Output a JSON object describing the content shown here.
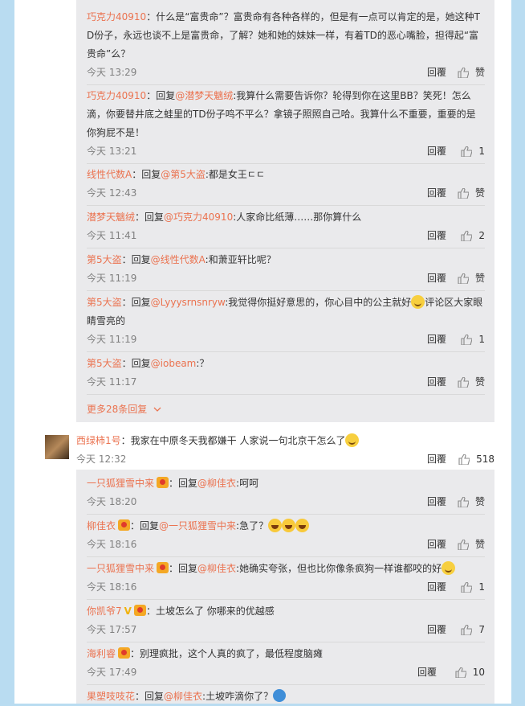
{
  "replies_top": [
    {
      "user": "巧克力40910",
      "prefix": "：",
      "mention": "",
      "text": "什么是“富贵命”？富贵命有各种各样的，但是有一点可以肯定的是，她这种TD份子，永远也谈不上是富贵命，了解？她和她的妹妹一样，有着TD的恶心嘴脸，担得起“富贵命”么？",
      "time": "今天 13:29",
      "reply_label": "回覆",
      "like": "赞"
    },
    {
      "user": "巧克力40910",
      "prefix": "：回复",
      "mention": "@潜梦天魑绒",
      "text": ":我算什么需要告诉你？轮得到你在这里BB？笑死！怎么滴，你要替井底之蛙里的TD份子鸣不平么？拿镜子照照自己哈。我算什么不重要，重要的是你狗屁不是！",
      "time": "今天 13:21",
      "reply_label": "回覆",
      "like": "1"
    },
    {
      "user": "线性代数A",
      "prefix": "：回复",
      "mention": "@第5大盗",
      "text": ":都是女王ㄷㄷ",
      "time": "今天 12:43",
      "reply_label": "回覆",
      "like": "赞"
    },
    {
      "user": "潜梦天魑绒",
      "prefix": "：回复",
      "mention": "@巧克力40910",
      "text": ":人家命比纸薄……那你算什么",
      "time": "今天 11:41",
      "reply_label": "回覆",
      "like": "2"
    },
    {
      "user": "第5大盗",
      "prefix": "：回复",
      "mention": "@线性代数A",
      "text": ":和萧亚轩比呢？",
      "time": "今天 11:19",
      "reply_label": "回覆",
      "like": "赞"
    },
    {
      "user": "第5大盗",
      "prefix": "：回复",
      "mention": "@Lyyysrnsnryw",
      "text": ":我觉得你挺好意思的，你心目中的公主就好",
      "text2": "评论区大家眼睛雪亮的",
      "time": "今天 11:19",
      "reply_label": "回覆",
      "like": "1"
    },
    {
      "user": "第5大盗",
      "prefix": "：回复",
      "mention": "@iobeam",
      "text": ":？",
      "time": "今天 11:17",
      "reply_label": "回覆",
      "like": "赞"
    }
  ],
  "more_replies": "更多28条回复",
  "main_comment": {
    "user": "西绿柿1号",
    "text": "：我家在中原冬天我都嫌干 人家说一句北京干怎么了",
    "time": "今天 12:32",
    "reply_label": "回覆",
    "like": "518"
  },
  "replies_bottom": [
    {
      "user": "一只狐狸雪中来",
      "prefix": "：回复",
      "mention": "@柳佳衣",
      "text": ":呵呵",
      "time": "今天 18:20",
      "reply_label": "回覆",
      "like": "赞"
    },
    {
      "user": "柳佳衣",
      "prefix": "：回复",
      "mention": "@一只狐狸雪中来",
      "text": ":急了？",
      "time": "今天 18:16",
      "reply_label": "回覆",
      "like": "赞"
    },
    {
      "user": "一只狐狸雪中来",
      "prefix": "：回复",
      "mention": "@柳佳衣",
      "text": ":她确实夸张，但也比你像条疯狗一样谁都咬的好",
      "time": "今天 18:16",
      "reply_label": "回覆",
      "like": "1"
    },
    {
      "user": "你凯爷7",
      "prefix": "：",
      "mention": "",
      "text": "土坡怎么了 你哪来的优越感",
      "time": "今天 17:57",
      "reply_label": "回覆",
      "like": "7"
    },
    {
      "user": "海利睿",
      "prefix": "：",
      "mention": "",
      "text": "别理疯批，这个人真的疯了，最低程度脑瘫",
      "time": "今天 17:49",
      "reply_label": "回覆",
      "like": "10"
    },
    {
      "user": "果塑吱吱花",
      "prefix": "：回复",
      "mention": "@柳佳衣",
      "text": ":土坡咋滴你了？",
      "time": "",
      "reply_label": "",
      "like": ""
    }
  ],
  "colors": {
    "background": "#b9dcf1",
    "link": "#eb7350",
    "reply_bg": "#eaeaec"
  }
}
